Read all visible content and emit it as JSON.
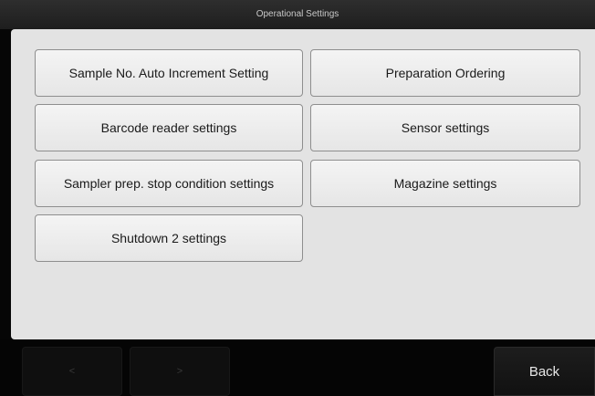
{
  "title": "Operational Settings",
  "buttons": {
    "sample_no_auto_increment": "Sample No. Auto Increment Setting",
    "preparation_ordering": "Preparation Ordering",
    "barcode_reader": "Barcode reader settings",
    "sensor": "Sensor settings",
    "sampler_prep_stop": "Sampler prep. stop condition settings",
    "magazine": "Magazine settings",
    "shutdown_2": "Shutdown 2 settings"
  },
  "footer": {
    "prev_glyph": "<",
    "next_glyph": ">",
    "back_label": "Back"
  }
}
